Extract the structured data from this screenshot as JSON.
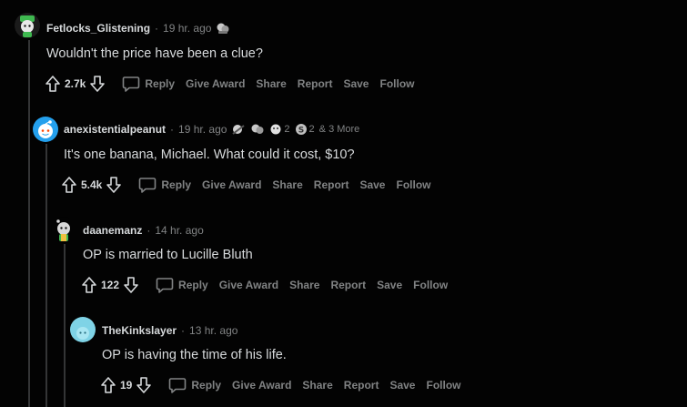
{
  "comments": [
    {
      "author": "Fetlocks_Glistening",
      "separator": "·",
      "time": "19 hr. ago",
      "body": "Wouldn't the price have been a clue?",
      "score": "2.7k",
      "avatar_color": "#3fb950",
      "awards": [
        {
          "icon": "award-icon",
          "count": ""
        }
      ]
    },
    {
      "author": "anexistentialpeanut",
      "separator": "·",
      "time": "19 hr. ago",
      "body": "It's one banana, Michael. What could it cost, $10?",
      "score": "5.4k",
      "avatar_color": "#24a0ed",
      "awards": [
        {
          "icon": "award-icon",
          "count": ""
        },
        {
          "icon": "award-icon",
          "count": ""
        },
        {
          "icon": "award-icon",
          "count": "2"
        },
        {
          "icon": "silver-coin-icon",
          "count": "2"
        }
      ],
      "more_awards": "& 3 More"
    },
    {
      "author": "daanemanz",
      "separator": "·",
      "time": "14 hr. ago",
      "body": "OP is married to Lucille Bluth",
      "score": "122",
      "avatar_color": "#2e2e2e"
    },
    {
      "author": "TheKinkslayer",
      "separator": "·",
      "time": "13 hr. ago",
      "body": "OP is having the time of his life.",
      "score": "19",
      "avatar_color": "#7fd3e6"
    }
  ],
  "actions": {
    "reply": "Reply",
    "give_award": "Give Award",
    "share": "Share",
    "report": "Report",
    "save": "Save",
    "follow": "Follow"
  },
  "colors": {
    "background": "#030303",
    "text": "#d7dadc",
    "muted": "#818384",
    "thread_line": "#343536"
  }
}
